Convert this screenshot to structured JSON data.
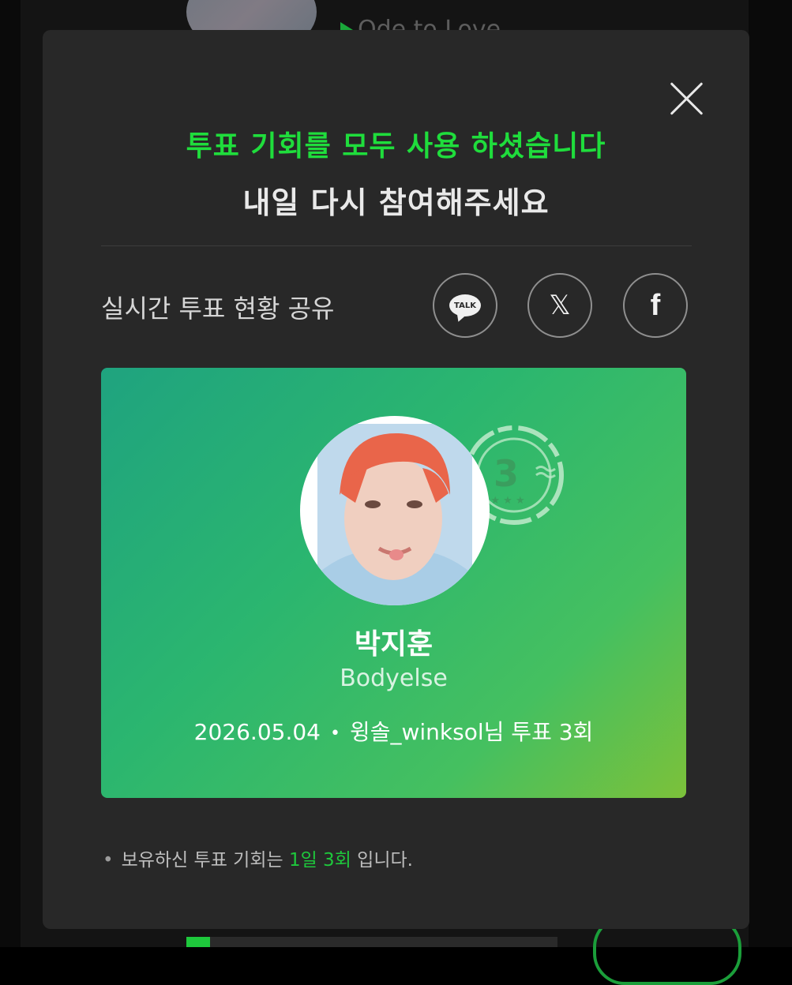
{
  "background": {
    "song_title": "Ode to Love"
  },
  "modal": {
    "title_line1": "투표 기회를 모두 사용 하셨습니다",
    "title_line2": "내일 다시 참여해주세요",
    "share_label": "실시간 투표 현황 공유",
    "share_buttons": [
      {
        "name": "kakaotalk",
        "icon": "kakaotalk-icon",
        "text": "TALK"
      },
      {
        "name": "x",
        "icon": "x-icon",
        "text": "𝕏"
      },
      {
        "name": "facebook",
        "icon": "facebook-icon",
        "text": "f"
      }
    ],
    "card": {
      "stamp_number": "3",
      "artist_name": "박지훈",
      "group_name": "Bodyelse",
      "date": "2026.05.04",
      "separator": "•",
      "vote_text": "윙솔_winksol님 투표 3회"
    },
    "note": {
      "bullet": "•",
      "prefix": "보유하신 투표 기회는",
      "highlight": "1일 3회",
      "suffix": "입니다."
    }
  },
  "colors": {
    "accent_green": "#1fdd3c",
    "modal_bg": "#282828",
    "card_gradient_start": "#1fa37f",
    "card_gradient_end": "#7cc13a"
  }
}
